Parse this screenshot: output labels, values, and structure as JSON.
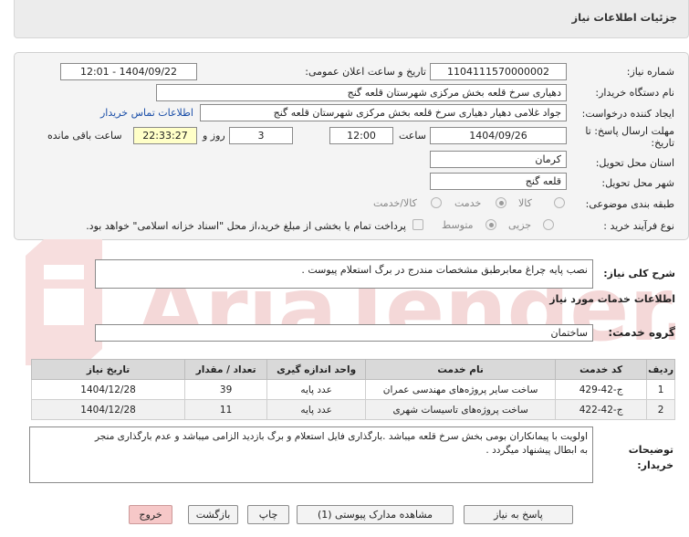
{
  "header": {
    "title": "جزئیات اطلاعات نیاز"
  },
  "form": {
    "need_number_label": "شماره نیاز:",
    "need_number": "1104111570000002",
    "announce_label": "تاریخ و ساعت اعلان عمومی:",
    "announce_value": "1404/09/22 - 12:01",
    "buyer_org_label": "نام دستگاه خریدار:",
    "buyer_org": "دهیاری سرخ قلعه بخش مرکزی شهرستان قلعه گنج",
    "creator_label": "ایجاد کننده درخواست:",
    "creator": "جواد غلامی دهیار دهیاری سرخ قلعه بخش مرکزی شهرستان قلعه گنج",
    "contact_link": "اطلاعات تماس خریدار",
    "deadline_label_1": "مهلت ارسال پاسخ: تا",
    "deadline_label_2": "تاریخ:",
    "deadline_date": "1404/09/26",
    "time_label": "ساعت",
    "deadline_time": "12:00",
    "days_value": "3",
    "days_label": "روز و",
    "remaining_time": "22:33:27",
    "remaining_label": "ساعت باقی مانده",
    "province_label": "استان محل تحویل:",
    "province": "کرمان",
    "city_label": "شهر محل تحویل:",
    "city": "قلعه گنج",
    "category_label": "طبقه بندی موضوعی:",
    "category_options": [
      "کالا",
      "خدمت",
      "کالا/خدمت"
    ],
    "process_label": "نوع فرآیند خرید :",
    "process_options": [
      "جزیی",
      "متوسط"
    ],
    "payment_note": "پرداخت تمام یا بخشی از مبلغ خرید،از محل \"اسناد خزانه اسلامی\" خواهد بود."
  },
  "description": {
    "label": "شرح کلی نیاز:",
    "value": "نصب پایه چراغ معابرطبق مشخصات مندرج در برگ استعلام پیوست ."
  },
  "services": {
    "section_title": "اطلاعات خدمات مورد نیاز",
    "group_label": "گروه خدمت:",
    "group_value": "ساختمان",
    "columns": [
      "ردیف",
      "کد خدمت",
      "نام خدمت",
      "واحد اندازه گیری",
      "تعداد / مقدار",
      "تاریخ نیاز"
    ],
    "rows": [
      [
        "1",
        "ج-42-429",
        "ساخت سایر پروژه‌های مهندسی عمران",
        "عدد پایه",
        "39",
        "1404/12/28"
      ],
      [
        "2",
        "ج-42-422",
        "ساخت پروژه‌های تاسیسات شهری",
        "عدد پایه",
        "11",
        "1404/12/28"
      ]
    ]
  },
  "buyer_notes": {
    "label_1": "توضیحات",
    "label_2": "خریدار:",
    "line_1": "اولویت با پیمانکاران بومی بخش سرخ قلعه میباشد .بارگذاری فایل استعلام و برگ بازدید الزامی میباشد و عدم بارگذاری منجر",
    "line_2": "به ابطال پیشنهاد میگردد ."
  },
  "buttons": {
    "reply": "پاسخ به نیاز",
    "view_docs": "مشاهده مدارک پیوستی (1)",
    "print": "چاپ",
    "back": "بازگشت",
    "exit": "خروج"
  },
  "watermark": {
    "text": "AriaTender.net"
  },
  "colors": {
    "link": "#1a4ea8",
    "remaining_bg": "#ffffc8",
    "exit_button": "#f6c8c8"
  }
}
